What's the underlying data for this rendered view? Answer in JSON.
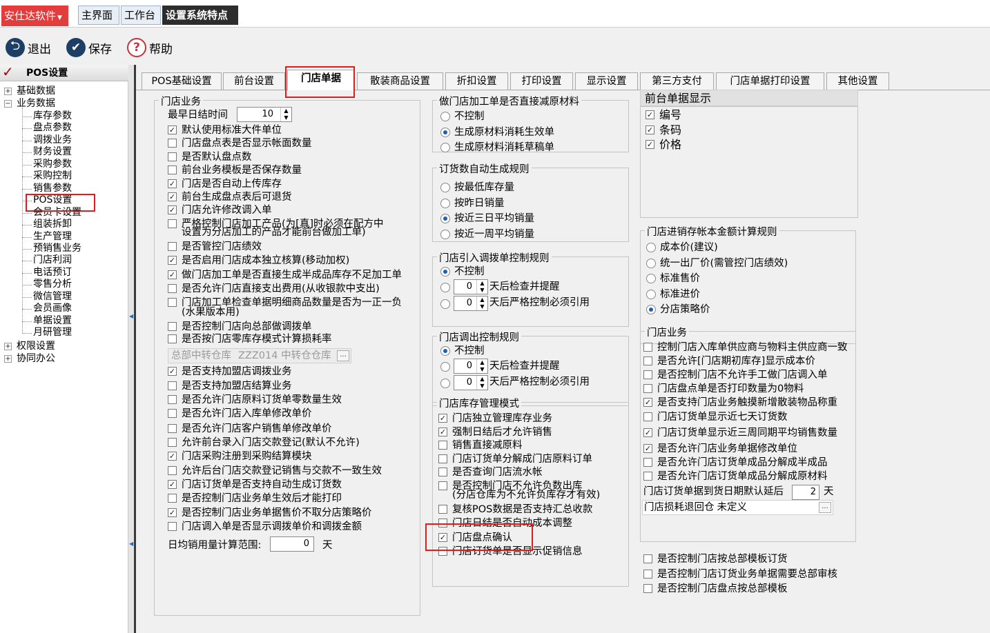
{
  "app": {
    "menu_label": "安仕达软件",
    "tabs": [
      "主界面",
      "工作台",
      "设置系统特点"
    ]
  },
  "toolbar": {
    "exit": "退出",
    "save": "保存",
    "help": "帮助"
  },
  "tree": {
    "header": "POS设置",
    "top_before": [
      {
        "label": "基础数据",
        "box": "+"
      },
      {
        "label": "业务数据",
        "box": "−"
      }
    ],
    "children": [
      "库存参数",
      "盘点参数",
      "调拨业务",
      "财务设置",
      "采购参数",
      "采购控制",
      "销售参数",
      "POS设置",
      "会员卡设置",
      "组装拆卸",
      "生产管理",
      "预销售业务",
      "门店利润",
      "电话预订",
      "零售分析",
      "微信管理",
      "会员画像",
      "单据设置",
      "月研管理"
    ],
    "top_after": [
      {
        "label": "权限设置",
        "box": "+"
      },
      {
        "label": "协同办公",
        "box": "+"
      }
    ]
  },
  "tabs": [
    "POS基础设置",
    "前台设置",
    "门店单据",
    "散装商品设置",
    "折扣设置",
    "打印设置",
    "显示设置",
    "第三方支付",
    "门店单据打印设置",
    "其他设置"
  ],
  "col1": {
    "title": "门店业务",
    "earliest_close_label": "最早日结时间",
    "earliest_close_value": "10",
    "checks1": [
      {
        "t": "默认使用标准大件单位",
        "c": true
      },
      {
        "t": "门店盘点表是否显示帐面数量",
        "c": false
      },
      {
        "t": "是否默认盘点数",
        "c": false
      },
      {
        "t": "前台业务模板是否保存数量",
        "c": false
      },
      {
        "t": "门店是否自动上传库存",
        "c": true
      },
      {
        "t": "前台生成盘点表后可退货",
        "c": true
      },
      {
        "t": "门店允许修改调入单",
        "c": true
      }
    ],
    "strict_line1": "严格控制门店加工产品(为[真]时必须在配方中",
    "strict_line2": "设置为分店加工的产品才能前台做加工单)",
    "checks2": [
      {
        "t": "是否管控门店绩效",
        "c": false
      },
      {
        "t": "是否启用门店成本独立核算(移动加权)",
        "c": true
      },
      {
        "t": "做门店加工单是否直接生成半成品库存不足加工单",
        "c": true
      },
      {
        "t": "是否允许门店直接支出费用(从收银款中支出)",
        "c": false
      }
    ],
    "detail_line1": "门店加工单检查单据明细商品数量是否为一正一负",
    "detail_line2": "(水果版本用)",
    "checks3": [
      {
        "t": "是否控制门店向总部做调拨单",
        "c": false
      },
      {
        "t": "是否按门店零库存模式计算损耗率",
        "c": false
      }
    ],
    "warehouse_label": "总部中转仓库",
    "warehouse_value": "ZZZ014  中转仓仓库",
    "checks4": [
      {
        "t": "是否支持加盟店调拨业务",
        "c": true
      },
      {
        "t": "是否支持加盟店结算业务",
        "c": false
      },
      {
        "t": "是否允许门店原料订货单零数量生效",
        "c": false
      },
      {
        "t": "是否允许门店入库单修改单价",
        "c": false
      },
      {
        "t": "是否允许门店客户销售单修改单价",
        "c": false
      },
      {
        "t": "允许前台录入门店交款登记(默认不允许)",
        "c": false
      },
      {
        "t": "门店采购注册到采购结算模块",
        "c": true
      },
      {
        "t": "允许后台门店交款登记销售与交款不一致生效",
        "c": false
      },
      {
        "t": "门店订货单是否支持自动生成订货数",
        "c": true
      },
      {
        "t": "是否控制门店业务单生效后才能打印",
        "c": false
      },
      {
        "t": "是否控制门店业务单据售价不取分店策略价",
        "c": true
      },
      {
        "t": "门店调入单是否显示调拨单价和调拨金额",
        "c": false
      }
    ],
    "avg_label": "日均销用量计算范围:",
    "avg_value": "0",
    "avg_unit": "天"
  },
  "col2": {
    "g1": {
      "title": "做门店加工单是否直接减原材料",
      "opts": [
        "不控制",
        "生成原材料消耗生效单",
        "生成原材料消耗草稿单"
      ],
      "sel": 1
    },
    "g2": {
      "title": "订货数自动生成规则",
      "opts": [
        "按最低库存量",
        "按昨日销量",
        "按近三日平均销量",
        "按近一周平均销量"
      ],
      "sel": 2
    },
    "g3": {
      "title": "门店引入调拨单控制规则",
      "opts": [
        "不控制"
      ],
      "spin1": "0",
      "spin1_text": "天后检查并提醒",
      "spin2": "0",
      "spin2_text": "天后严格控制必须引用"
    },
    "g4": {
      "title": "门店调出控制规则",
      "opts": [
        "不控制"
      ],
      "spin1": "0",
      "spin1_text": "天后检查并提醒",
      "spin2": "0",
      "spin2_text": "天后严格控制必须引用"
    },
    "g5": {
      "title": "门店库存管理模式",
      "checks": [
        {
          "t": "门店独立管理库存业务",
          "c": true
        },
        {
          "t": "强制日结后才允许销售",
          "c": true
        },
        {
          "t": "销售直接减原料",
          "c": false
        },
        {
          "t": "门店订货单分解成门店原料订单",
          "c": false
        },
        {
          "t": "是否查询门店流水帐",
          "c": false
        }
      ],
      "neg_line1": "是否控制门店不允许负数出库",
      "neg_line2": "(分店仓库为不允许负库存才有效)",
      "checks2": [
        {
          "t": "复核POS数据是否支持汇总收款",
          "c": false
        },
        {
          "t": "门店日结是否自动成本调整",
          "c": false
        },
        {
          "t": "门店盘点确认",
          "c": true
        },
        {
          "t": "门店订货单是否显示促销信息",
          "c": false
        }
      ]
    }
  },
  "col3": {
    "front_title": "前台单据显示",
    "front_items": [
      {
        "t": "编号",
        "c": true
      },
      {
        "t": "条码",
        "c": true
      },
      {
        "t": "价格",
        "c": true
      }
    ],
    "cost": {
      "title": "门店进销存帐本金额计算规则",
      "opts": [
        "成本价(建议)",
        "统一出厂价(需管控门店绩效)",
        "标准售价",
        "标准进价",
        "分店策略价"
      ],
      "sel": 4
    },
    "biz": {
      "title": "门店业务",
      "checks": [
        {
          "t": "控制门店入库单供应商与物料主供应商一致",
          "c": false
        },
        {
          "t": "是否允许[门店期初库存]显示成本价",
          "c": false
        },
        {
          "t": "是否控制门店不允许手工做门店调入单",
          "c": false
        },
        {
          "t": "门店盘点单是否打印数量为0物料",
          "c": false
        },
        {
          "t": "是否支持门店业务触摸新增散装物品称重",
          "c": true
        },
        {
          "t": "门店订货单显示近七天订货数",
          "c": false
        },
        {
          "t": "门店订货单显示近三周同期平均销售数量",
          "c": true
        },
        {
          "t": "是否允许门店业务单据修改单位",
          "c": true
        },
        {
          "t": "是否允许门店订货单成品分解成半成品",
          "c": false
        },
        {
          "t": "是否允许门店订货单成品分解成原材料",
          "c": false
        }
      ],
      "delay_label": "门店订货单据到货日期默认延后",
      "delay_value": "2",
      "delay_unit": "天",
      "loss_label": "门店损耗退回仓",
      "loss_value": "未定义"
    },
    "bottom_checks": [
      {
        "t": "是否控制门店按总部模板订货",
        "c": false
      },
      {
        "t": "是否控制门店订货业务单据需要总部审核",
        "c": false
      },
      {
        "t": "是否控制门店盘点按总部模板",
        "c": false
      }
    ]
  }
}
